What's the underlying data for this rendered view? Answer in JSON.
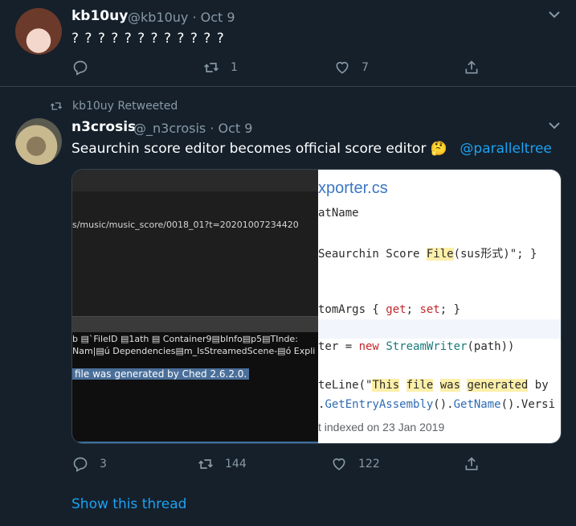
{
  "tweet1": {
    "author_name": "kb10uy",
    "author_handle": "@kb10uy",
    "date": "· Oct 9",
    "text": "? ? ? ? ? ? ? ? ? ? ? ?",
    "reply_count": "",
    "retweet_count": "1",
    "like_count": "7"
  },
  "tweet2": {
    "retweeted_by": "kb10uy Retweeted",
    "author_name": "n3crosis",
    "author_handle": "@_n3crosis",
    "date": "· Oct 9",
    "text": "Seaurchin score editor becomes official score editor 🤔",
    "mention": "@paralleltree",
    "reply_count": "3",
    "retweet_count": "144",
    "like_count": "122",
    "show_thread": "Show this thread",
    "media": {
      "left": {
        "url": "s/music/music_score/0018_01?t=20201007234420",
        "line1": "b ▤`FileID ▤1ath   ▤   Container9▤bInfo▤p5▤TInde:",
        "line2": "Nam|▤ú Dependencies▤m_IsStreamedScene-▤ó Expli",
        "highlight": "file was generated by Ched 2.6.2.0."
      },
      "right": {
        "title": "xporter.cs",
        "code1": "atName",
        "code2_prefix": "Seaurchin Score ",
        "code2_mark": "File",
        "code2_suffix": "(sus形式)\"; }",
        "code3_prefix": "tomArgs { ",
        "code3_get": "get",
        "code3_mid": "; ",
        "code3_set": "set",
        "code3_suffix": "; }",
        "code4_prefix": "ter = ",
        "code4_new": "new",
        "code4_type": "StreamWriter",
        "code4_suffix": "(path))",
        "code5_prefix": "teLine(\"",
        "code5_this": "This",
        "code5_file": "file",
        "code5_was": "was",
        "code5_generated": "generated",
        "code5_by": " by",
        "code6_prefix": ".",
        "code6_fn1": "GetEntryAssembly",
        "code6_mid": "().",
        "code6_fn2": "GetName",
        "code6_suffix": "().Versi",
        "footer": "t indexed on 23 Jan 2019"
      }
    }
  },
  "colors": {
    "background": "#15202b",
    "accent": "#1da1f2",
    "secondary_text": "#8899a6",
    "divider": "#38444d"
  },
  "icons": {
    "reply": "reply-icon",
    "retweet": "retweet-icon",
    "like": "heart-icon",
    "share": "share-icon",
    "caret": "chevron-down-icon"
  }
}
